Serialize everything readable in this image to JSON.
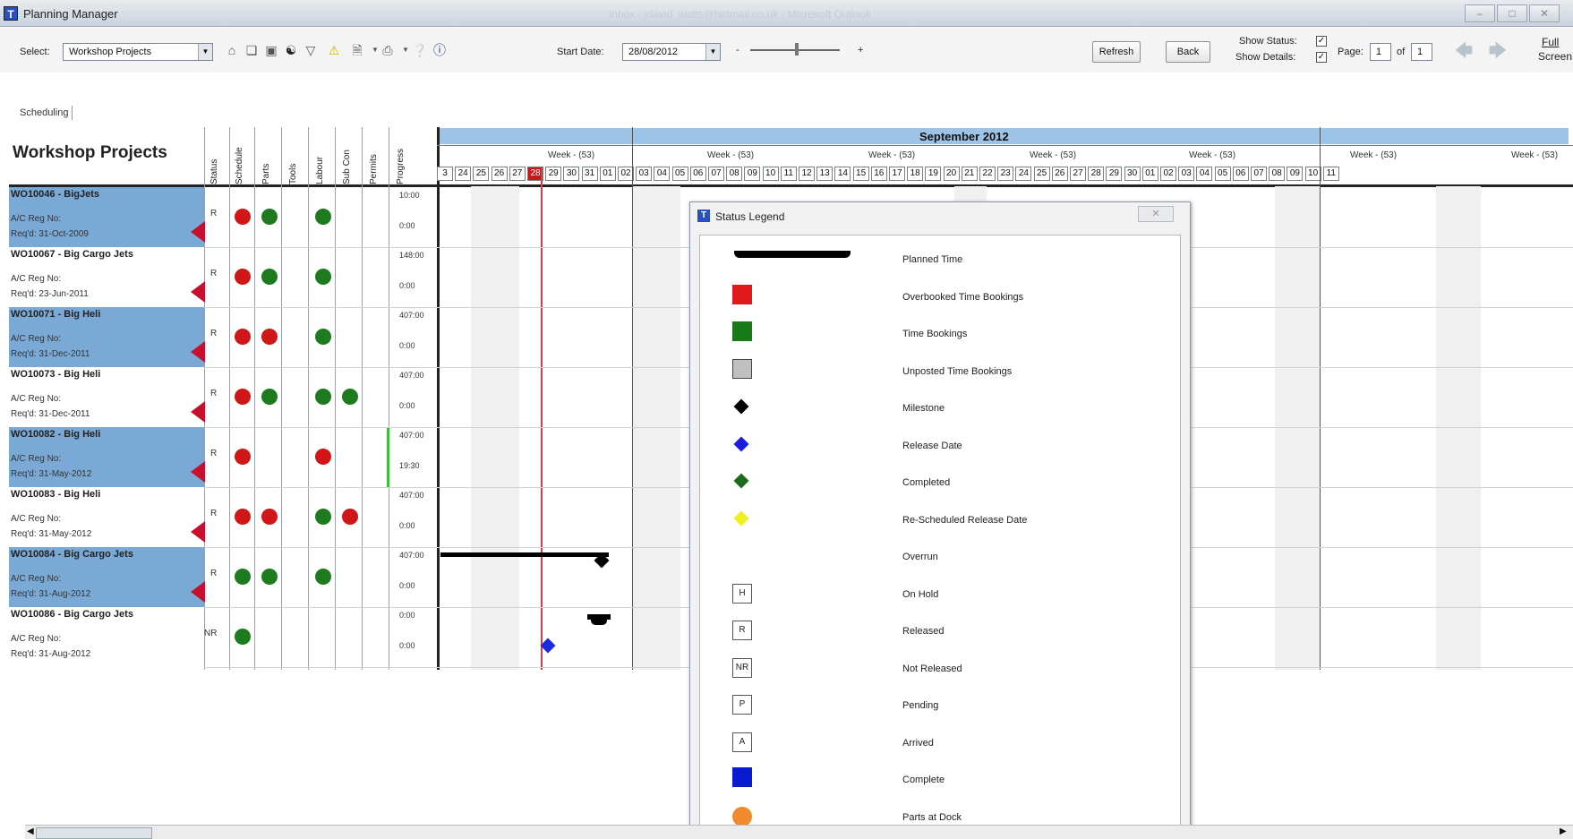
{
  "window": {
    "title": "Planning Manager",
    "faded_caption": "Inbox - jdavid_watts@hotmail.co.uk - Microsoft Outlook"
  },
  "toolbar": {
    "select_label": "Select:",
    "select_value": "Workshop Projects",
    "start_date_label": "Start Date:",
    "start_date_value": "28/08/2012",
    "zoom_minus": "-",
    "zoom_plus": "+",
    "refresh_label": "Refresh",
    "back_label": "Back",
    "show_status_label": "Show Status:",
    "show_details_label": "Show Details:",
    "page_label": "Page:",
    "page_value": "1",
    "of_label": "of",
    "page_total": "1",
    "full_screen_label_1": "Full",
    "full_screen_label_2": "Screen"
  },
  "tab": {
    "label": "Scheduling"
  },
  "grid": {
    "title": "Workshop Projects",
    "columns": [
      "Status",
      "Schedule",
      "Parts",
      "Tools",
      "Labour",
      "Sub Con",
      "Permits",
      "Progress"
    ],
    "month": "September 2012",
    "week_label": "Week - (53)",
    "days": [
      "3",
      "24",
      "25",
      "26",
      "27",
      "28",
      "29",
      "30",
      "31",
      "01",
      "02",
      "03",
      "04",
      "05",
      "06",
      "07",
      "08",
      "09",
      "10",
      "11",
      "12",
      "13",
      "14",
      "15",
      "16",
      "17",
      "18",
      "19",
      "20",
      "21",
      "22",
      "23",
      "24",
      "25",
      "26",
      "27",
      "28",
      "29",
      "30",
      "01",
      "02",
      "03",
      "04",
      "05",
      "06",
      "07",
      "08",
      "09",
      "10",
      "11"
    ],
    "rows": [
      {
        "title": "WO10046 - BigJets",
        "reg": "A/C Reg No:",
        "req": "Req'd: 31-Oct-2009",
        "status": "R",
        "prog_top": "10:00",
        "prog_bot": "0:00"
      },
      {
        "title": "WO10067 - Big Cargo Jets",
        "reg": "A/C Reg No:",
        "req": "Req'd: 23-Jun-2011",
        "status": "R",
        "prog_top": "148:00",
        "prog_bot": "0:00"
      },
      {
        "title": "WO10071 - Big Heli",
        "reg": "A/C Reg No:",
        "req": "Req'd: 31-Dec-2011",
        "status": "R",
        "prog_top": "407:00",
        "prog_bot": "0:00"
      },
      {
        "title": "WO10073 - Big Heli",
        "reg": "A/C Reg No:",
        "req": "Req'd: 31-Dec-2011",
        "status": "R",
        "prog_top": "407:00",
        "prog_bot": "0:00"
      },
      {
        "title": "WO10082 - Big Heli",
        "reg": "A/C Reg No:",
        "req": "Req'd: 31-May-2012",
        "status": "R",
        "prog_top": "407:00",
        "prog_bot": "19:30"
      },
      {
        "title": "WO10083 - Big Heli",
        "reg": "A/C Reg No:",
        "req": "Req'd: 31-May-2012",
        "status": "R",
        "prog_top": "407:00",
        "prog_bot": "0:00"
      },
      {
        "title": "WO10084 - Big Cargo Jets",
        "reg": "A/C Reg No:",
        "req": "Req'd: 31-Aug-2012",
        "status": "R",
        "prog_top": "407:00",
        "prog_bot": "0:00"
      },
      {
        "title": "WO10086 - Big Cargo Jets",
        "reg": "A/C Reg No:",
        "req": "Req'd: 31-Aug-2012",
        "status": "NR",
        "prog_top": "0:00",
        "prog_bot": "0:00"
      }
    ]
  },
  "legend": {
    "title": "Status Legend",
    "items": [
      {
        "label": "Planned Time"
      },
      {
        "label": "Overbooked Time Bookings",
        "color": "#e01a1a"
      },
      {
        "label": "Time Bookings",
        "color": "#167a16"
      },
      {
        "label": "Unposted Time Bookings",
        "color": "#c0c0c0"
      },
      {
        "label": "Milestone",
        "color": "#000000"
      },
      {
        "label": "Release Date",
        "color": "#1a1ae0"
      },
      {
        "label": "Completed",
        "color": "#1e6a1e"
      },
      {
        "label": "Re-Scheduled Release Date",
        "color": "#f0f020"
      },
      {
        "label": "Overrun"
      },
      {
        "label": "On Hold",
        "code": "H"
      },
      {
        "label": "Released",
        "code": "R"
      },
      {
        "label": "Not Released",
        "code": "NR"
      },
      {
        "label": "Pending",
        "code": "P"
      },
      {
        "label": "Arrived",
        "code": "A"
      },
      {
        "label": "Complete",
        "color": "#0a1ad0"
      },
      {
        "label": "Parts at Dock",
        "color": "#f08a2a"
      }
    ]
  },
  "colors": {
    "today": "#c21a1a",
    "month_bar": "#9dc3e6",
    "selected_row": "#7aa9d6"
  }
}
